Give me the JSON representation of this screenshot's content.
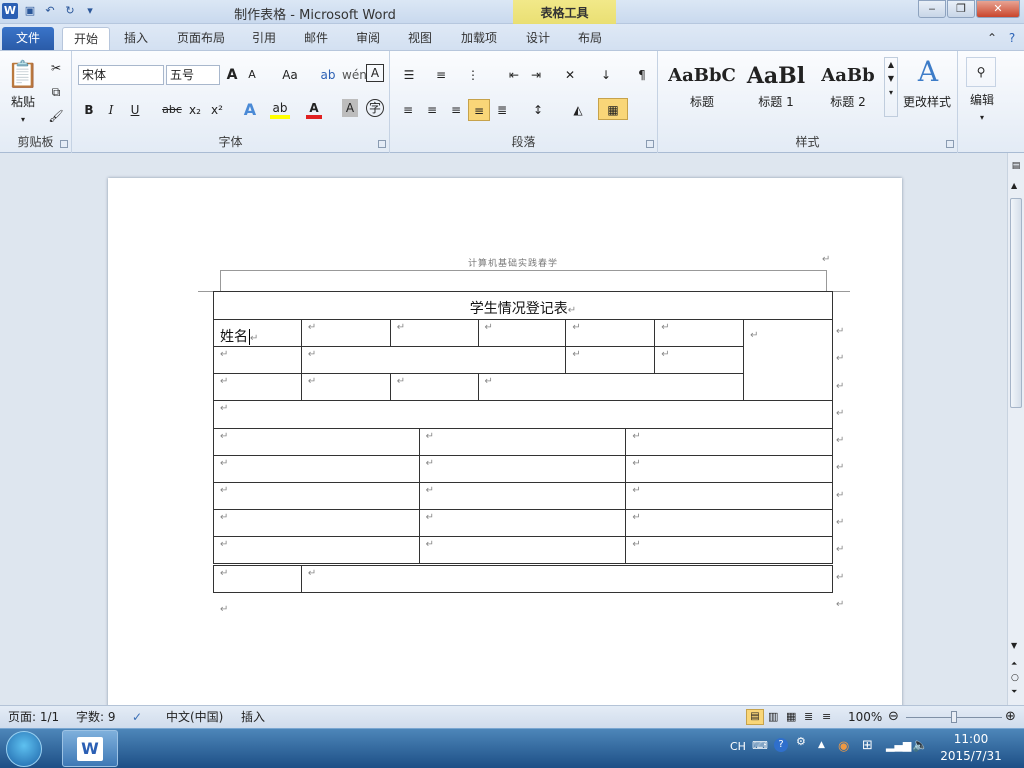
{
  "window": {
    "title": "制作表格 - Microsoft Word",
    "context_tab": "表格工具",
    "buttons": [
      "‒",
      "❐",
      "✕"
    ]
  },
  "tabs": [
    "文件",
    "开始",
    "插入",
    "页面布局",
    "引用",
    "邮件",
    "审阅",
    "视图",
    "加载项",
    "设计",
    "布局"
  ],
  "ribbon": {
    "clipboard": {
      "label": "剪贴板",
      "paste": "粘贴"
    },
    "font": {
      "label": "字体",
      "font_name": "宋体",
      "font_size": "五号",
      "bold": "B",
      "italic": "I",
      "underline": "U",
      "strike": "abc",
      "sub": "x₂",
      "sup": "x²",
      "grow": "A",
      "shrink": "A",
      "case": "Aa",
      "clear": "A"
    },
    "paragraph": {
      "label": "段落"
    },
    "styles": {
      "label": "样式",
      "items": [
        {
          "sample": "AaBbC",
          "name": "标题"
        },
        {
          "sample": "AaBl",
          "name": "标题 1"
        },
        {
          "sample": "AaBb",
          "name": "标题 2"
        }
      ],
      "change": "更改样式"
    },
    "editing": {
      "label": "编辑"
    }
  },
  "document": {
    "header_text": "计算机基础实践春学",
    "table_title": "学生情况登记表",
    "first_cell": "姓名",
    "return_mark": "↵"
  },
  "status": {
    "page": "页面: 1/1",
    "words": "字数: 9",
    "language": "中文(中国)",
    "mode": "插入",
    "zoom": "100%"
  },
  "taskbar": {
    "ime": "CH",
    "time": "11:00",
    "date": "2015/7/31"
  }
}
